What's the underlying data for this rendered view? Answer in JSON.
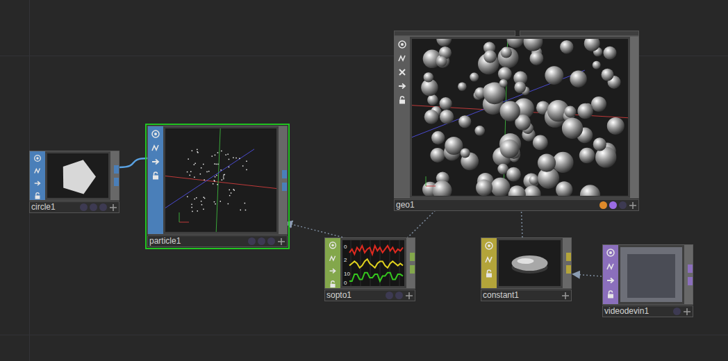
{
  "nodes": [
    {
      "name": "circle1",
      "kind": "sop",
      "viewer": "shape",
      "selected": false,
      "flags": [
        false,
        false,
        false
      ]
    },
    {
      "name": "particle1",
      "kind": "sop",
      "viewer": "points",
      "selected": true,
      "flags": [
        false,
        false,
        false
      ]
    },
    {
      "name": "geo1",
      "kind": "comp",
      "viewer": "render",
      "selected": false,
      "flags": [
        true,
        true,
        false
      ]
    },
    {
      "name": "sopto1",
      "kind": "chop",
      "viewer": "chart",
      "selected": false,
      "flags": [
        false,
        false
      ],
      "chart": {
        "labels": [
          "0",
          "2",
          "10",
          "0"
        ],
        "series": [
          {
            "color": "#e02a20",
            "values": [
              3,
              5,
              2,
              6,
              4,
              7,
              3,
              5,
              6,
              2,
              7,
              4,
              6,
              3,
              5,
              7,
              4,
              6,
              3,
              5,
              4,
              6
            ]
          },
          {
            "color": "#e0d21e",
            "values": [
              4,
              5,
              6,
              5,
              3,
              4,
              6,
              7,
              5,
              4,
              3,
              5,
              6,
              6,
              4,
              3,
              5,
              6,
              5,
              4,
              5,
              4
            ]
          },
          {
            "color": "#35c81e",
            "values": [
              2,
              2,
              6,
              6,
              3,
              3,
              7,
              7,
              4,
              4,
              6,
              6,
              2,
              5,
              5,
              7,
              7,
              3,
              3,
              6,
              6,
              5
            ]
          }
        ]
      }
    },
    {
      "name": "constant1",
      "kind": "mat",
      "viewer": "material",
      "selected": false,
      "flags": []
    },
    {
      "name": "videodevin1",
      "kind": "top",
      "viewer": "video",
      "selected": false,
      "flags": [
        false
      ]
    }
  ],
  "wires": [
    {
      "from": "circle1",
      "to": "particle1",
      "kind": "link"
    },
    {
      "from": "sopto1",
      "to": "particle1",
      "kind": "reference"
    },
    {
      "from": "sopto1",
      "to": "geo1",
      "kind": "reference"
    },
    {
      "from": "constant1",
      "to": "geo1",
      "kind": "reference"
    },
    {
      "from": "videodevin1",
      "to": "constant1",
      "kind": "reference"
    }
  ]
}
